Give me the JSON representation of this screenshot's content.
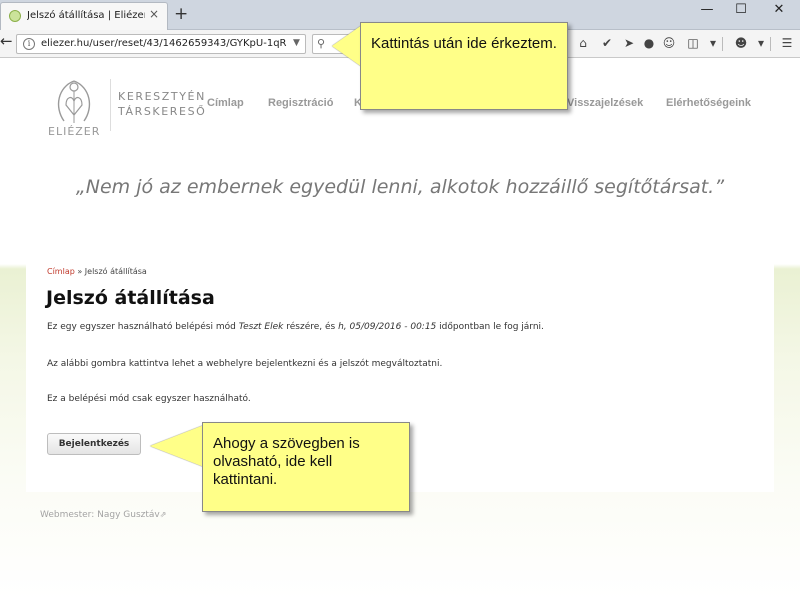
{
  "browser": {
    "tab_title": "Jelszó átállítása | Eliézer - K...",
    "tab_close": "×",
    "new_tab": "+",
    "url": "eliezer.hu/user/reset/43/1462659343/GYKpU-1qR",
    "minimize": "—",
    "maximize": "☐",
    "close": "✕"
  },
  "site": {
    "logo_sub": "ELIÉZER",
    "logo_line1": "KERESZTYÉN",
    "logo_line2": "TÁRSKERESŐ",
    "menu": [
      "Címlap",
      "Regisztráció",
      "K",
      "Visszajelzések",
      "Elérhetőségeink"
    ],
    "tagline": "„Nem jó az embernek egyedül lenni, alkotok hozzáillő segítőtársat.”"
  },
  "content": {
    "breadcrumb_link": "Címlap",
    "breadcrumb_sep": " » ",
    "breadcrumb_current": "Jelszó átállítása",
    "title": "Jelszó átállítása",
    "para1_a": "Ez egy egyszer használható belépési mód ",
    "para1_name": "Teszt Elek",
    "para1_b": " részére, és ",
    "para1_date": "h, 05/09/2016 - 00:15",
    "para1_c": " időpontban le fog járni.",
    "para2": "Az alábbi gombra kattintva lehet a webhelyre bejelentkezni és a jelszót megváltoztatni.",
    "para3": "Ez a belépési mód csak egyszer használható.",
    "login_button": "Bejelentkezés"
  },
  "footer": {
    "webmaster": "Webmester: Nagy Gusztáv"
  },
  "callouts": {
    "top": "Kattintás után ide érkeztem.",
    "bottom": "Ahogy a szövegben is olvasható, ide kell kattintani."
  },
  "colors": {
    "callout": "#ffff88",
    "breadcrumb_link": "#c0392b"
  }
}
